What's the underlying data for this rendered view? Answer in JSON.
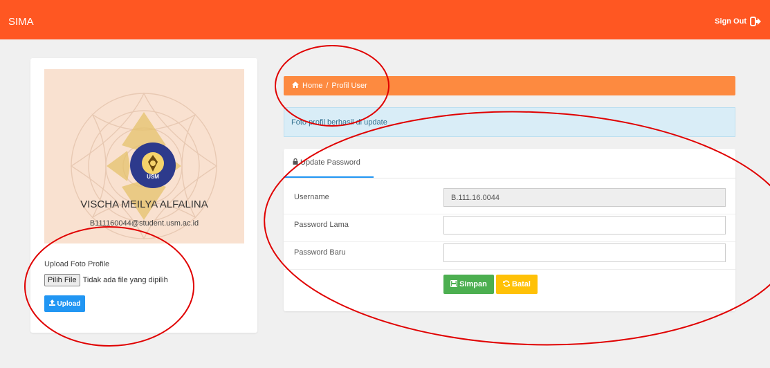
{
  "app": {
    "title": "SIMA",
    "signout_label": "Sign Out"
  },
  "profile": {
    "name": "VISCHA MEILYA ALFALINA",
    "email": "B111160044@student.usm.ac.id",
    "logo_text": "USM",
    "upload_label": "Upload Foto Profile",
    "file_button": "Pilih File",
    "file_status": "Tidak ada file yang dipilih",
    "upload_button": "Upload"
  },
  "breadcrumb": {
    "home": "Home",
    "separator": "/",
    "current": "Profil User"
  },
  "alert": {
    "message": "Foto profil berhasil di update"
  },
  "panel": {
    "tab_label": "Update Password",
    "fields": [
      {
        "label": "Username",
        "value": "B.111.16.0044",
        "readonly": true
      },
      {
        "label": "Password Lama",
        "value": "",
        "readonly": false
      },
      {
        "label": "Password Baru",
        "value": "",
        "readonly": false
      }
    ],
    "save_label": "Simpan",
    "cancel_label": "Batal"
  },
  "colors": {
    "topbar": "#ff5722",
    "breadcrumb": "#fd8a40",
    "alert_bg": "#d9edf7",
    "upload": "#2196f3",
    "save": "#4caf50",
    "cancel": "#ffc107",
    "annotation": "#e00000"
  }
}
